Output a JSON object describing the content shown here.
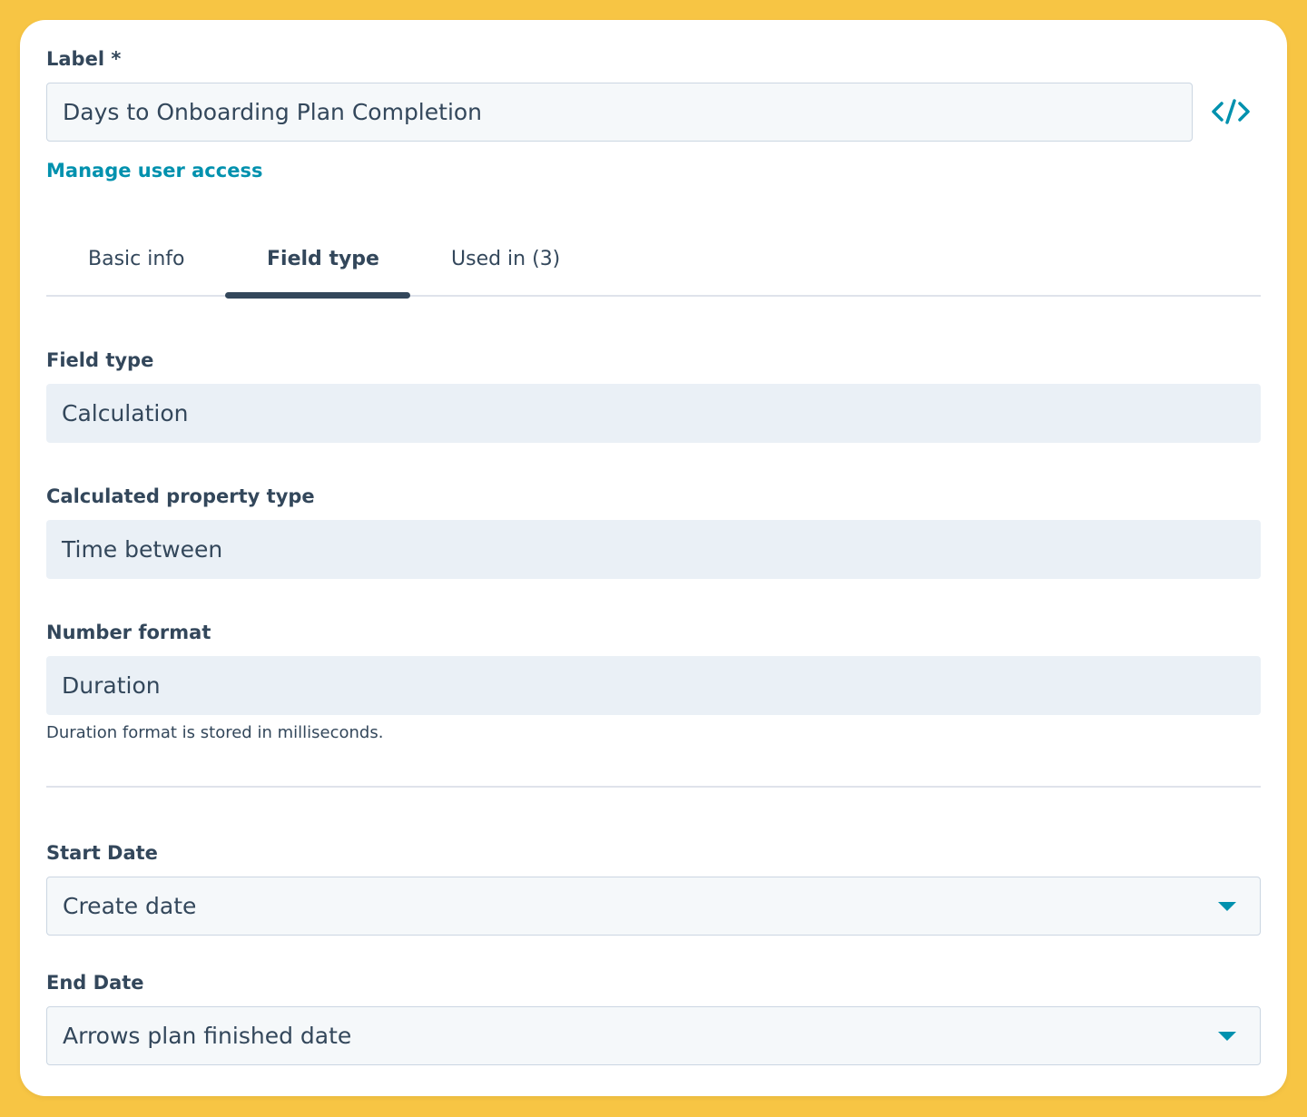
{
  "label_field": {
    "label": "Label *",
    "value": "Days to Onboarding Plan Completion"
  },
  "icons": {
    "code": "code-icon",
    "dropdown": "caret-down-icon"
  },
  "manage_access_link": "Manage user access",
  "tabs": [
    {
      "label": "Basic info",
      "active": false
    },
    {
      "label": "Field type",
      "active": true
    },
    {
      "label": "Used in (3)",
      "active": false
    }
  ],
  "field_type": {
    "label": "Field type",
    "value": "Calculation"
  },
  "calculated_property_type": {
    "label": "Calculated property type",
    "value": "Time between"
  },
  "number_format": {
    "label": "Number format",
    "value": "Duration",
    "help": "Duration format is stored in milliseconds."
  },
  "start_date": {
    "label": "Start Date",
    "value": "Create date"
  },
  "end_date": {
    "label": "End Date",
    "value": "Arrows plan finished date"
  },
  "colors": {
    "background": "#f7c544",
    "text": "#33475b",
    "link": "#0091ae",
    "input_bg": "#f5f8fa",
    "readonly_bg": "#eaf0f6",
    "border": "#cbd6e2"
  }
}
